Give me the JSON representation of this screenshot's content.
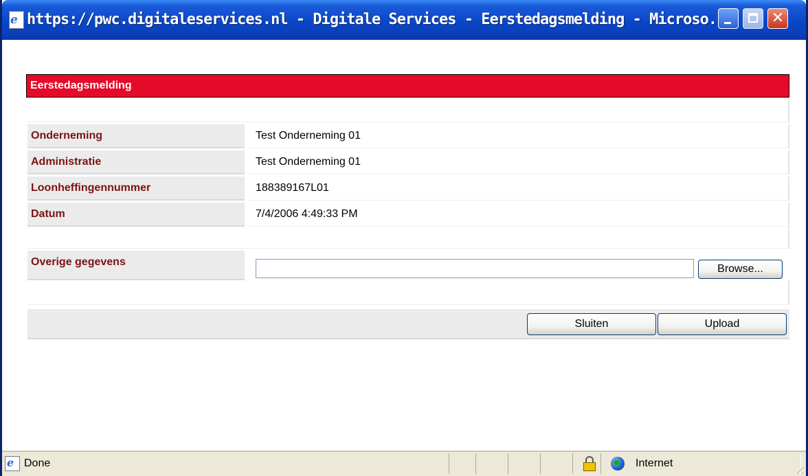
{
  "window": {
    "title": "https://pwc.digitaleservices.nl - Digitale Services - Eerstedagsmelding - Microso...",
    "minimize_icon": "minimize-icon",
    "maximize_icon": "maximize-icon",
    "close_icon": "close-icon",
    "close_glyph": "✕"
  },
  "form": {
    "heading": "Eerstedagsmelding",
    "heading_color": "#e50a29",
    "label_color": "#7b1212",
    "fields": [
      {
        "label": "Onderneming",
        "value": "Test Onderneming 01"
      },
      {
        "label": "Administratie",
        "value": "Test Onderneming 01"
      },
      {
        "label": "Loonheffingennummer",
        "value": "188389167L01"
      },
      {
        "label": "Datum",
        "value": "7/4/2006 4:49:33 PM"
      }
    ],
    "upload": {
      "label": "Overige gegevens",
      "file_value": "",
      "browse_label": "Browse..."
    },
    "buttons": {
      "close_label": "Sluiten",
      "upload_label": "Upload"
    }
  },
  "statusbar": {
    "status_text": "Done",
    "zone_text": "Internet",
    "page_icon": "ie-page-icon",
    "lock_icon": "lock-icon",
    "zone_icon": "globe-icon"
  }
}
